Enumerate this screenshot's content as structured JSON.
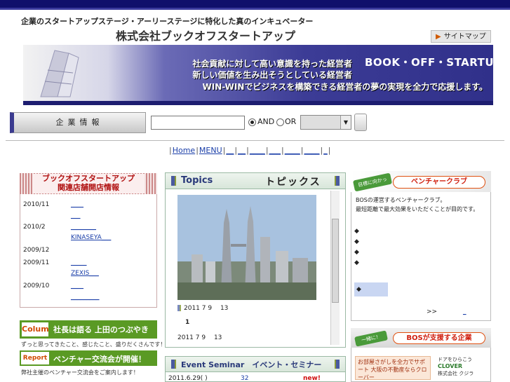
{
  "header": {
    "tagline": "企業のスタートアップステージ・アーリーステージに特化した真のインキュベーター",
    "company": "株式会社ブックオフスタートアップ",
    "sitemap_label": "サイトマップ"
  },
  "banner": {
    "brand": "BOOK・OFF・STARTUP",
    "line1": "社会貢献に対して高い意識を持った経営者",
    "line2": "新しい価値を生み出そうとしている経営者",
    "line3": "WIN-WINでビジネスを構築できる経営者の夢の実現を全力で応援します。"
  },
  "search": {
    "label": "企業情報",
    "input_value": "",
    "and_label": "AND",
    "or_label": "OR",
    "select_value": ""
  },
  "nav": {
    "items": [
      "Home",
      "MENU",
      "",
      "",
      "",
      "",
      "",
      "",
      ""
    ]
  },
  "stores": {
    "title_line1": "ブックオフスタートアップ",
    "title_line2": "関連店舗開店情報",
    "rows": [
      {
        "date": "2010/11",
        "link": "____"
      },
      {
        "date": "",
        "link": "___"
      },
      {
        "date": "2010/2",
        "link": "________"
      },
      {
        "date": "",
        "link": "KINASEYA___"
      },
      {
        "date": "2009/12",
        "link": ""
      },
      {
        "date": "2009/11",
        "link": "_____"
      },
      {
        "date": "",
        "link": "ZEXIS___"
      },
      {
        "date": "2009/10",
        "link": "____"
      },
      {
        "date": "",
        "link": "_________"
      }
    ]
  },
  "column": {
    "tag": "Colum",
    "title": "社長は語る 上田のつぶやき",
    "caption": "ずっと思ってきたこと、感じたこと、盛りだくさんです！"
  },
  "report": {
    "tag": "Report",
    "title": "ベンチャー交流会が開催！",
    "caption": "弊社主催のベンチャー交流会をご案内します！"
  },
  "topics": {
    "title_en": "Topics",
    "title_jp": "トピックス",
    "rows": [
      {
        "text": "2011 7 9　 13"
      },
      {
        "text": "1"
      },
      {
        "text": "2011 7 9　 13"
      }
    ]
  },
  "event": {
    "title": "Event Seminar　イベント・セミナー",
    "date": "2011.6.29( )",
    "num": "32",
    "new_label": "new!"
  },
  "venture": {
    "goal_label": "目標に向かって！",
    "title": "ベンチャークラブ",
    "line1": "BOSの運営するベンチャークラブ。",
    "line2": "最短距離で最大効果をいただくことが目的です。",
    "bullets": [
      "◆",
      "◆",
      "◆",
      "◆"
    ],
    "select_bullet": "◆",
    "more": ">>",
    "under": "_"
  },
  "support": {
    "goal_label": "一緒に！",
    "title": "BOSが支援する企業",
    "promo": "お部屋さがしを全力でサポート 大阪の不動産ならクローバー",
    "clover_line1": "ドアをひらこう",
    "clover_logo": "CLOVER",
    "clover_company": "株式会社 クジラ"
  }
}
